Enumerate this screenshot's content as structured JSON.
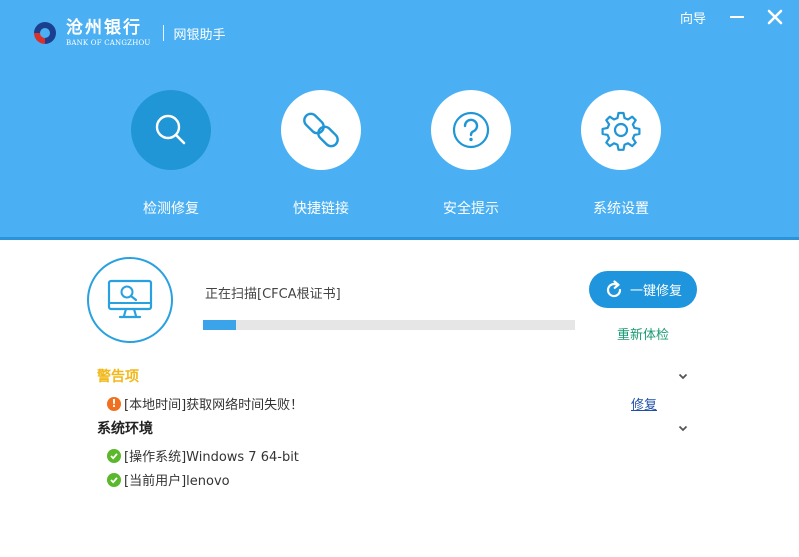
{
  "app": {
    "bank_name_cn": "沧州银行",
    "bank_name_en": "BANK OF CANGZHOU",
    "subtitle": "网银助手",
    "guide_label": "向导"
  },
  "nav": {
    "items": [
      {
        "label": "检测修复",
        "icon": "search-icon",
        "active": true
      },
      {
        "label": "快捷链接",
        "icon": "link-icon",
        "active": false
      },
      {
        "label": "安全提示",
        "icon": "question-icon",
        "active": false
      },
      {
        "label": "系统设置",
        "icon": "gear-icon",
        "active": false
      }
    ]
  },
  "scan": {
    "status_text": "正在扫描[CFCA根证书]",
    "progress": 0.09,
    "one_key_repair_label": "一键修复",
    "recheck_label": "重新体检"
  },
  "warnings": {
    "title": "警告项",
    "items": [
      {
        "text": "[本地时间]获取网络时间失败！",
        "action": "修复"
      }
    ]
  },
  "environment": {
    "title": "系统环境",
    "items": [
      {
        "text": "[操作系统]Windows 7 64-bit"
      },
      {
        "text": "[当前用户]lenovo"
      }
    ]
  },
  "colors": {
    "header_bg": "#4bb0f3",
    "accent": "#1e95dd",
    "warning_title": "#f2b81b",
    "ok_green": "#5ab82a",
    "warn_orange": "#f07020",
    "recheck_green": "#1a9a72"
  }
}
